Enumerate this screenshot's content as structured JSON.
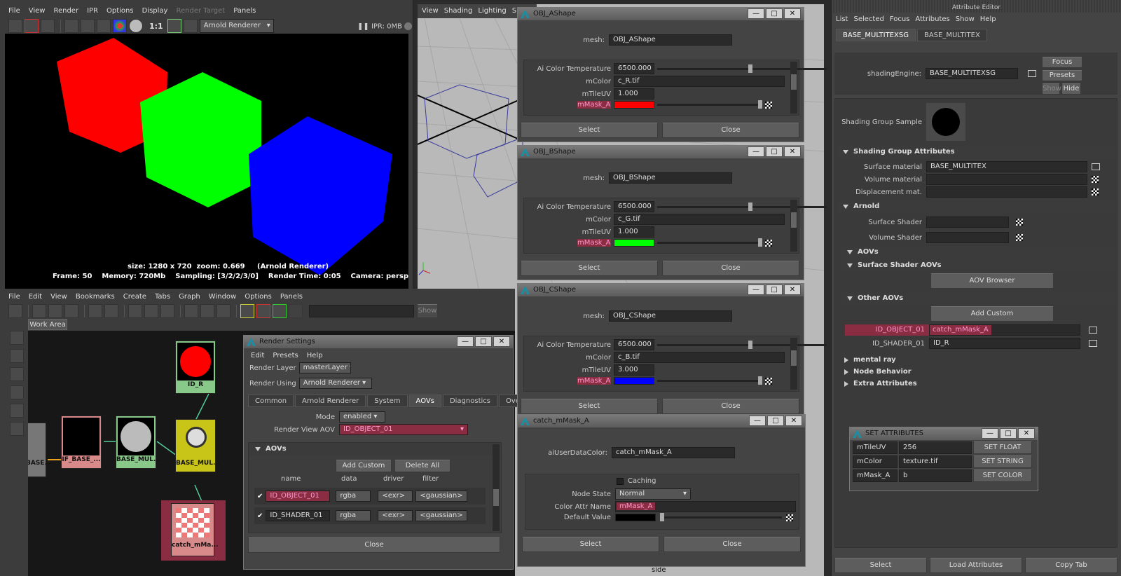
{
  "render_view": {
    "menu": [
      "File",
      "View",
      "Render",
      "IPR",
      "Options",
      "Display",
      "Render Target",
      "Panels"
    ],
    "renderer": "Arnold Renderer",
    "zoom_ratio": "1:1",
    "ipr_memory": "IPR: 0MB",
    "info_line1": "size: 1280 x 720  zoom: 0.669     (Arnold Renderer)",
    "info_line2": "Frame: 50    Memory: 720Mb    Sampling: [3/2/2/3/0]    Render Time: 0:05    Camera: perspShape"
  },
  "viewport": {
    "menu": [
      "View",
      "Shading",
      "Lighting",
      "Show"
    ],
    "axis_label": "side"
  },
  "hypershade": {
    "menu": [
      "File",
      "Edit",
      "View",
      "Bookmarks",
      "Create",
      "Tabs",
      "Graph",
      "Window",
      "Options",
      "Panels"
    ],
    "show_button": "Show",
    "tab": "Work Area",
    "nodes": {
      "base_left": "BASE...",
      "if_base": "IF_BASE_...",
      "base_mul1": "BASE_MUL...",
      "base_mul2": "BASE_MUL...",
      "id_r": "ID_R",
      "catch": "catch_mMa..."
    }
  },
  "render_settings": {
    "title": "Render Settings",
    "menu": [
      "Edit",
      "Presets",
      "Help"
    ],
    "render_layer_label": "Render Layer",
    "render_layer_value": "masterLayer",
    "render_using_label": "Render Using",
    "render_using_value": "Arnold Renderer",
    "tabs": [
      "Common",
      "Arnold Renderer",
      "System",
      "AOVs",
      "Diagnostics",
      "Override"
    ],
    "mode_label": "Mode",
    "mode_value": "enabled",
    "render_view_aov_label": "Render View AOV",
    "render_view_aov_value": "ID_OBJECT_01",
    "aovs_section": "AOVs",
    "add_custom": "Add Custom",
    "delete_all": "Delete All",
    "col_headers": [
      "name",
      "data",
      "driver",
      "filter"
    ],
    "rows": [
      {
        "name": "ID_OBJECT_01",
        "data": "rgba",
        "driver": "<exr>",
        "filter": "<gaussian>"
      },
      {
        "name": "ID_SHADER_01",
        "data": "rgba",
        "driver": "<exr>",
        "filter": "<gaussian>"
      }
    ],
    "close": "Close"
  },
  "shape_windows": [
    {
      "title": "OBJ_AShape",
      "mesh_label": "mesh:",
      "mesh": "OBJ_AShape",
      "temp_label": "Ai Color Temperature",
      "temp": "6500.000",
      "mcolor_label": "mColor",
      "mcolor": "c_R.tif",
      "mtile_label": "mTileUV",
      "mtile": "1.000",
      "mask_label": "mMask_A",
      "mask_color": "#ff0000",
      "select": "Select",
      "close": "Close"
    },
    {
      "title": "OBJ_BShape",
      "mesh_label": "mesh:",
      "mesh": "OBJ_BShape",
      "temp_label": "Ai Color Temperature",
      "temp": "6500.000",
      "mcolor_label": "mColor",
      "mcolor": "c_G.tif",
      "mtile_label": "mTileUV",
      "mtile": "1.000",
      "mask_label": "mMask_A",
      "mask_color": "#00ff00",
      "select": "Select",
      "close": "Close"
    },
    {
      "title": "OBJ_CShape",
      "mesh_label": "mesh:",
      "mesh": "OBJ_CShape",
      "temp_label": "Ai Color Temperature",
      "temp": "6500.000",
      "mcolor_label": "mColor",
      "mcolor": "c_B.tif",
      "mtile_label": "mTileUV",
      "mtile": "3.000",
      "mask_label": "mMask_A",
      "mask_color": "#0000ff",
      "select": "Select",
      "close": "Close"
    }
  ],
  "catch_window": {
    "title": "catch_mMask_A",
    "user_data_label": "aiUserDataColor:",
    "user_data_value": "catch_mMask_A",
    "caching_label": "Caching",
    "node_state_label": "Node State",
    "node_state_value": "Normal",
    "color_attr_label": "Color Attr Name",
    "color_attr_value": "mMask_A",
    "default_value_label": "Default Value",
    "select": "Select",
    "close": "Close"
  },
  "attribute_editor": {
    "title": "Attribute Editor",
    "menu": [
      "List",
      "Selected",
      "Focus",
      "Attributes",
      "Show",
      "Help"
    ],
    "tabs": [
      "BASE_MULTITEXSG",
      "BASE_MULTITEX"
    ],
    "focus": "Focus",
    "presets": "Presets",
    "show": "Show",
    "hide": "Hide",
    "shading_engine_label": "shadingEngine:",
    "shading_engine_value": "BASE_MULTITEXSG",
    "sample_label": "Shading Group Sample",
    "sg_attrs_section": "Shading Group Attributes",
    "surface_material_label": "Surface material",
    "surface_material_value": "BASE_MULTITEX",
    "volume_material_label": "Volume material",
    "displacement_label": "Displacement mat.",
    "arnold_section": "Arnold",
    "surface_shader_label": "Surface Shader",
    "volume_shader_label": "Volume Shader",
    "aovs_section": "AOVs",
    "surface_shader_aovs_section": "Surface Shader AOVs",
    "aov_browser": "AOV Browser",
    "other_aovs_section": "Other AOVs",
    "add_custom": "Add Custom",
    "aov_rows": [
      {
        "name": "ID_OBJECT_01",
        "value": "catch_mMask_A"
      },
      {
        "name": "ID_SHADER_01",
        "value": "ID_R"
      }
    ],
    "mental_ray": "mental ray",
    "node_behavior": "Node Behavior",
    "extra_attributes": "Extra Attributes",
    "bottom_select": "Select",
    "load_attributes": "Load Attributes",
    "copy_tab": "Copy Tab"
  },
  "set_attributes": {
    "title": "SET ATTRIBUTES",
    "rows": [
      {
        "name": "mTileUV",
        "value": "256",
        "button": "SET FLOAT"
      },
      {
        "name": "mColor",
        "value": "texture.tif",
        "button": "SET STRING"
      },
      {
        "name": "mMask_A",
        "value": "b",
        "button": "SET COLOR"
      }
    ]
  },
  "colors": {
    "red": "#ff0000",
    "green": "#00ff00",
    "blue": "#0000ff",
    "aov_highlight": "#8a2d42",
    "node_yellow": "#c9c418",
    "node_green": "#88c98a",
    "node_pink": "#d88a8a"
  }
}
